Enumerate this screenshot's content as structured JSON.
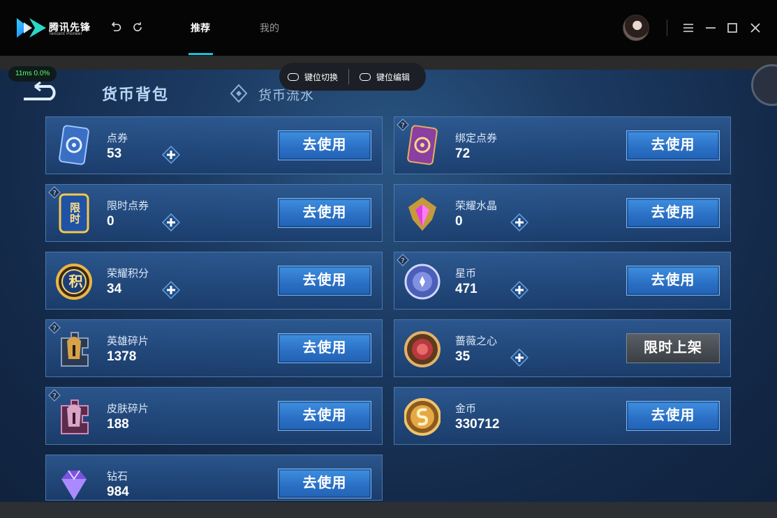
{
  "app": {
    "logo_text": "腾讯先锋",
    "logo_subtext": "Tencent Pioneer",
    "tabs": [
      {
        "label": "推荐",
        "active": true
      },
      {
        "label": "我的",
        "active": false
      }
    ]
  },
  "overlay": {
    "ping": "11ms  0.0%",
    "key_switch": "键位切换",
    "key_edit": "键位编辑"
  },
  "page": {
    "title": "货币背包",
    "flow_tab": "货币流水"
  },
  "colors": {
    "accent": "#1ec1d8",
    "ping_green": "#5cff6a",
    "button_blue": "#2a6fc4"
  },
  "currencies": [
    {
      "name": "点券",
      "count": "53",
      "icon": "voucher-icon",
      "has_help": false,
      "has_plus": true,
      "button": "去使用",
      "button_type": "use"
    },
    {
      "name": "绑定点券",
      "count": "72",
      "icon": "bound-voucher-icon",
      "has_help": true,
      "has_plus": false,
      "button": "去使用",
      "button_type": "use"
    },
    {
      "name": "限时点券",
      "count": "0",
      "icon": "limited-voucher-icon",
      "icon_label": "限时",
      "has_help": true,
      "has_plus": true,
      "button": "去使用",
      "button_type": "use"
    },
    {
      "name": "荣耀水晶",
      "count": "0",
      "icon": "glory-crystal-icon",
      "has_help": false,
      "has_plus": true,
      "button": "去使用",
      "button_type": "use"
    },
    {
      "name": "荣耀积分",
      "count": "34",
      "icon": "glory-points-icon",
      "icon_label": "积",
      "has_help": false,
      "has_plus": true,
      "button": "去使用",
      "button_type": "use"
    },
    {
      "name": "星币",
      "count": "471",
      "icon": "star-coin-icon",
      "has_help": true,
      "has_plus": true,
      "button": "去使用",
      "button_type": "use"
    },
    {
      "name": "英雄碎片",
      "count": "1378",
      "icon": "hero-fragment-icon",
      "has_help": true,
      "has_plus": false,
      "button": "去使用",
      "button_type": "use"
    },
    {
      "name": "蔷薇之心",
      "count": "35",
      "icon": "rose-heart-icon",
      "has_help": false,
      "has_plus": true,
      "button": "限时上架",
      "button_type": "limited"
    },
    {
      "name": "皮肤碎片",
      "count": "188",
      "icon": "skin-fragment-icon",
      "has_help": true,
      "has_plus": false,
      "button": "去使用",
      "button_type": "use"
    },
    {
      "name": "金币",
      "count": "330712",
      "icon": "gold-coin-icon",
      "has_help": false,
      "has_plus": false,
      "button": "去使用",
      "button_type": "use"
    },
    {
      "name": "钻石",
      "count": "984",
      "icon": "diamond-icon",
      "has_help": false,
      "has_plus": false,
      "button": "去使用",
      "button_type": "use"
    }
  ]
}
